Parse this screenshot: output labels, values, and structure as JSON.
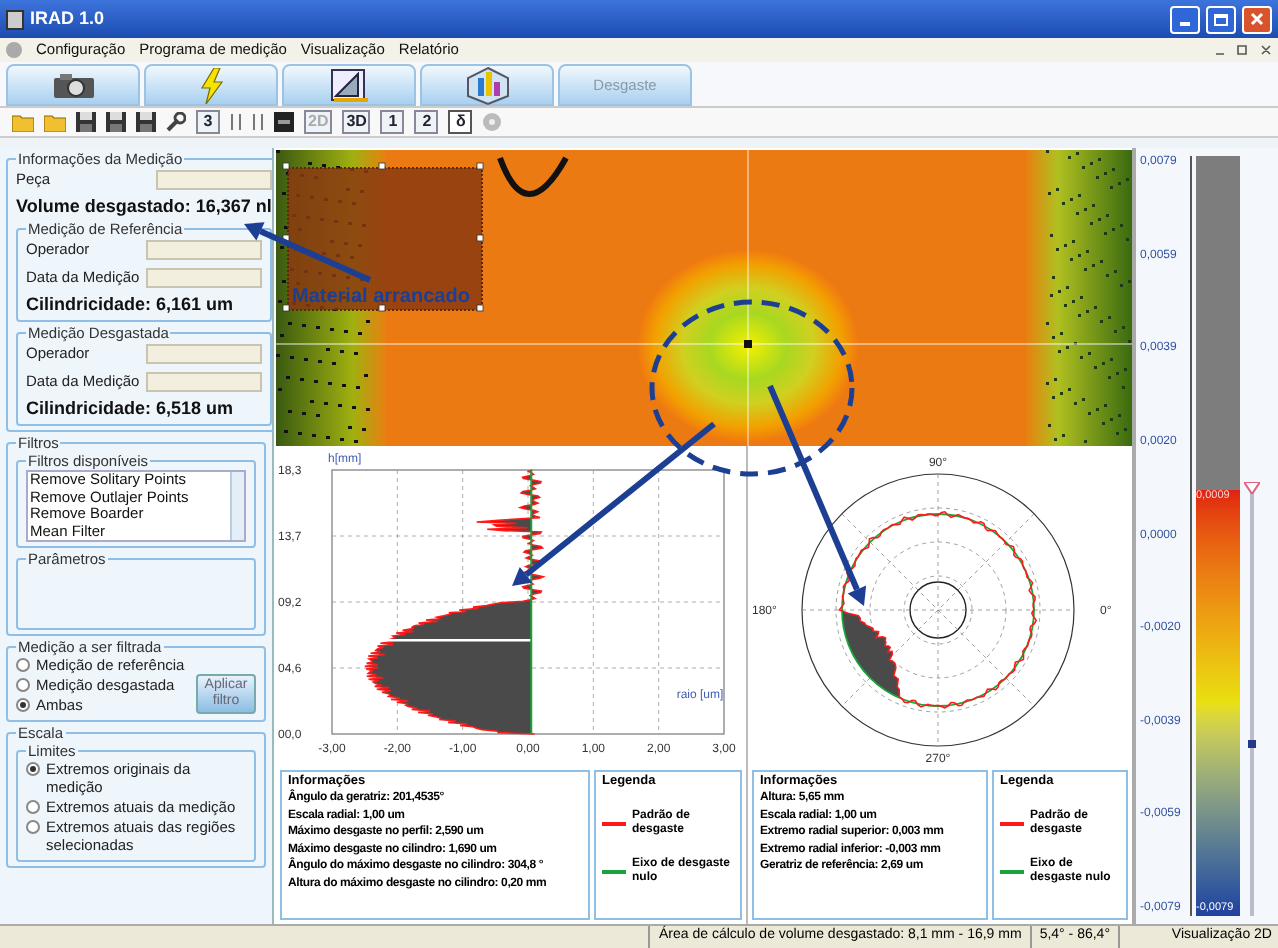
{
  "window": {
    "title": "IRAD 1.0"
  },
  "menu": [
    "Configuração",
    "Programa de medição",
    "Visualização",
    "Relatório"
  ],
  "big_tabs": [
    {
      "kind": "camera"
    },
    {
      "kind": "lightning"
    },
    {
      "kind": "drafting"
    },
    {
      "kind": "chart"
    },
    {
      "kind": "text",
      "label": "Desgaste"
    }
  ],
  "toolbar": [
    {
      "kind": "folder"
    },
    {
      "kind": "folder"
    },
    {
      "kind": "floppy"
    },
    {
      "kind": "floppy"
    },
    {
      "kind": "floppy"
    },
    {
      "kind": "wrench"
    },
    {
      "kind": "glyph",
      "label": "3",
      "disabled": false,
      "pressed": false
    },
    {
      "kind": "bars"
    },
    {
      "kind": "bars"
    },
    {
      "kind": "block"
    },
    {
      "kind": "glyph",
      "label": "2D",
      "disabled": true,
      "pressed": false
    },
    {
      "kind": "glyph",
      "label": "3D",
      "disabled": false,
      "pressed": false
    },
    {
      "kind": "glyph",
      "label": "1",
      "disabled": false,
      "pressed": false
    },
    {
      "kind": "glyph",
      "label": "2",
      "disabled": false,
      "pressed": false
    },
    {
      "kind": "glyph",
      "label": "δ",
      "disabled": false,
      "pressed": true
    },
    {
      "kind": "gear"
    }
  ],
  "measurement_info": {
    "title": "Informações da Medição",
    "fields": [
      {
        "label": "Peça"
      }
    ],
    "volume": "Volume desgastado: 16,367 nl"
  },
  "reference": {
    "title": "Medição de Referência",
    "fields": [
      {
        "label": "Operador"
      },
      {
        "label": "Data da Medição"
      }
    ],
    "cylindricity": "Cilindricidade: 6,161 um"
  },
  "worn": {
    "title": "Medição Desgastada",
    "fields": [
      {
        "label": "Operador"
      },
      {
        "label": "Data da Medição"
      }
    ],
    "cylindricity": "Cilindricidade: 6,518 um"
  },
  "filters": {
    "title": "Filtros",
    "available_title": "Filtros disponíveis",
    "available": [
      "Remove Solitary Points",
      "Remove Outlajer Points",
      "Remove Boarder",
      "Mean Filter"
    ],
    "parameters_title": "Parâmetros"
  },
  "filter_target": {
    "title": "Medição a ser filtrada",
    "options": [
      {
        "label": "Medição de referência",
        "selected": false
      },
      {
        "label": "Medição desgastada",
        "selected": false
      },
      {
        "label": "Ambas",
        "selected": true
      }
    ],
    "button": "Aplicar filtro"
  },
  "scale": {
    "title": "Escala",
    "limits_title": "Limites",
    "options": [
      {
        "label": "Extremos originais da medição",
        "selected": true
      },
      {
        "label": "Extremos atuais da medição",
        "selected": false
      },
      {
        "label": "Extremos atuais das regiões selecionadas",
        "selected": false
      }
    ]
  },
  "annotation": "Material arrancado",
  "profile_chart": {
    "ylabel": "h[mm]",
    "xlabel": "raio [um]",
    "yticks": [
      "18,3",
      "13,7",
      "09,2",
      "04,6",
      "00,0"
    ],
    "xticks": [
      "-3,00",
      "-2,00",
      "-1,00",
      "0,00",
      "1,00",
      "2,00",
      "3,00"
    ]
  },
  "profile_info": {
    "title": "Informações",
    "lines": [
      "Ângulo da geratriz: 201,4535°",
      "Escala radial: 1,00 um",
      "Máximo desgaste no perfil: 2,590 um",
      "Máximo desgaste no cilindro: 1,690 um",
      "Ângulo do máximo desgaste no cilindro: 304,8 °",
      "Altura do máximo desgaste no cilindro: 0,20 mm"
    ]
  },
  "profile_legend": {
    "title": "Legenda",
    "items": [
      {
        "label": "Padrão de desgaste",
        "color": "#ff1a1a"
      },
      {
        "label": "Eixo de desgaste nulo",
        "color": "#1aa33a"
      }
    ]
  },
  "polar_chart": {
    "labels": [
      "90°",
      "180°",
      "0°",
      "270°"
    ]
  },
  "polar_info": {
    "title": "Informações",
    "lines": [
      "Altura: 5,65 mm",
      "Escala radial: 1,00 um",
      "Extremo radial superior: 0,003 mm",
      "Extremo radial inferior: -0,003 mm",
      "Geratriz de referência: 2,69 um"
    ]
  },
  "polar_legend": {
    "title": "Legenda",
    "items": [
      {
        "label": "Padrão de desgaste",
        "color": "#ff1a1a"
      },
      {
        "label": "Eixo de desgaste nulo",
        "color": "#1aa33a"
      }
    ]
  },
  "color_scale": {
    "ticks": [
      "0,0079",
      "0,0059",
      "0,0039",
      "0,0020",
      "0,0000",
      "-0,0020",
      "-0,0039",
      "-0,0059",
      "-0,0079"
    ],
    "upper": "0,0009",
    "lower": "-0,0079",
    "slider": {
      "level": 0.22
    }
  },
  "status_bar": [
    "Área de cálculo de volume desgastado: 8,1 mm - 16,9 mm",
    "5,4° - 86,4°",
    "Visualização 2D"
  ]
}
